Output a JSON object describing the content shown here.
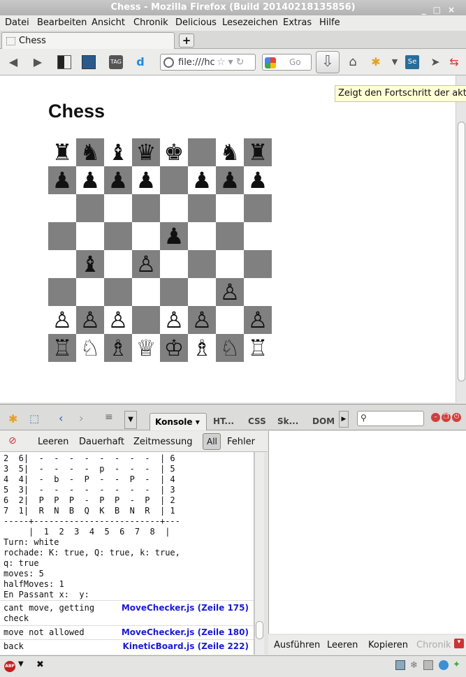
{
  "window": {
    "title": "Chess - Mozilla Firefox (Build 20140218135856)",
    "controls": [
      "_",
      "□",
      "×"
    ]
  },
  "menu": [
    {
      "label": "Datei"
    },
    {
      "label": "Bearbeiten"
    },
    {
      "label": "Ansicht"
    },
    {
      "label": "Chronik"
    },
    {
      "label": "Delicious"
    },
    {
      "label": "Lesezeichen"
    },
    {
      "label": "Extras"
    },
    {
      "label": "Hilfe"
    }
  ],
  "tab": {
    "title": "Chess",
    "new_tab": "+"
  },
  "navbar": {
    "url": "file:///hc",
    "search_placeholder": "Go",
    "tooltip": "Zeigt den Fortschritt der aktue"
  },
  "page": {
    "title": "Chess",
    "board": [
      [
        "♜",
        "♞",
        "♝",
        "♛",
        "♚",
        "",
        "♞",
        "♜"
      ],
      [
        "♟",
        "♟",
        "♟",
        "♟",
        "",
        "♟",
        "♟",
        "♟"
      ],
      [
        "",
        "",
        "",
        "",
        "",
        "",
        "",
        ""
      ],
      [
        "",
        "",
        "",
        "",
        "♟",
        "",
        "",
        ""
      ],
      [
        "",
        "♝",
        "",
        "♙",
        "",
        "",
        "",
        ""
      ],
      [
        "",
        "",
        "",
        "",
        "",
        "",
        "♙",
        ""
      ],
      [
        "♙",
        "♙",
        "♙",
        "",
        "♙",
        "♙",
        "",
        "♙"
      ],
      [
        "♖",
        "♘",
        "♗",
        "♕",
        "♔",
        "♗",
        "♘",
        "♖"
      ]
    ]
  },
  "devtools": {
    "tabs": [
      "Konsole ▾",
      "HT...",
      "CSS",
      "Sk...",
      "DOM"
    ],
    "console_toolbar": [
      "Leeren",
      "Dauerhaft",
      "Zeitmessung",
      "All",
      "Fehler"
    ],
    "console_text": "2  6|  -  -  -  -  -  -  -  -  | 6\n3  5|  -  -  -  -  p  -  -  -  | 5\n4  4|  -  b  -  P  -  -  P  -  | 4\n5  3|  -  -  -  -  -  -  -  -  | 3\n6  2|  P  P  P  -  P  P  -  P  | 2\n7  1|  R  N  B  Q  K  B  N  R  | 1\n-----+-------------------------+---\n     |  1  2  3  4  5  6  7  8  |\nTurn: white\nrochade: K: true, Q: true, k: true,\nq: true\nmoves: 5\nhalfMoves: 1\nEn Passant x:  y:",
    "log_rows": [
      {
        "msg": "cant move, getting\ncheck",
        "src": "MoveChecker.js (Zeile 175)"
      },
      {
        "msg": "move not allowed",
        "src": "MoveChecker.js (Zeile 180)"
      },
      {
        "msg": "back",
        "src": "KineticBoard.js (Zeile 222)"
      }
    ],
    "command_bar": [
      "Ausführen",
      "Leeren",
      "Kopieren",
      "Chronik"
    ]
  },
  "statusbar": {
    "abp": "ABP",
    "close": "✖"
  }
}
